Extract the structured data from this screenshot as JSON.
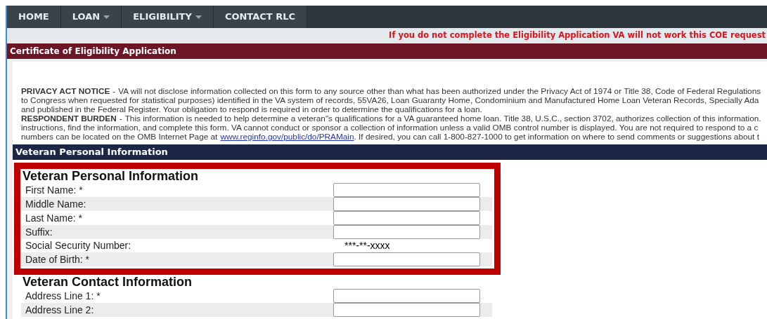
{
  "nav": [
    {
      "label": "HOME",
      "dropdown": false
    },
    {
      "label": "LOAN",
      "dropdown": true
    },
    {
      "label": "ELIGIBILITY",
      "dropdown": true
    },
    {
      "label": "CONTACT RLC",
      "dropdown": false
    }
  ],
  "warning": "If you do not complete the Eligibility Application VA will not work this COE request",
  "page_title": "Certificate of Eligibility Application",
  "notice": [
    {
      "heading": "PRIVACY ACT NOTICE",
      "separator": "-",
      "lines": [
        "VA will not disclose information collected on this form to any source other than what has been authorized under the Privacy Act of 1974 or Title 38, Code of Federal Regulations",
        "to Congress when requested for statistical purposes) identified in the VA system of records, 55VA26, Loan Guaranty Home, Condominium and Manufactured Home Loan Veteran Records, Specially Ada",
        "and published in the Federal Register. Your obligation to respond is required in order to determine the qualifications for a loan."
      ]
    },
    {
      "heading": "RESPONDENT BURDEN",
      "separator": "-",
      "lines": [
        "This information is needed to help determine a veteran\"s qualifications for a VA guaranteed home loan. Title 38, U.S.C., section 3702, authorizes collection of this information.",
        "instructions, find the information, and complete this form. VA cannot conduct or sponsor a collection of information unless a valid OMB control number is displayed. You are not required to respond to a c"
      ],
      "last_line": {
        "before": "numbers can be located on the OMB Internet Page at",
        "link": "www.reginfo.gov/public/do/PRAMain",
        "after": ". If desired, you can call 1-800-827-1000 to get information on where to send comments or suggestions about t"
      }
    }
  ],
  "section_header": "Veteran Personal Information",
  "groups": [
    {
      "title": "Veteran Personal Information",
      "highlighted": true,
      "fields": [
        {
          "label": "First Name: *",
          "kind": "input"
        },
        {
          "label": "Middle Name:",
          "kind": "input"
        },
        {
          "label": "Last Name: *",
          "kind": "input"
        },
        {
          "label": "Suffix:",
          "kind": "input"
        },
        {
          "label": "Social Security Number:",
          "kind": "text",
          "value": "***-**-xxxx"
        },
        {
          "label": "Date of Birth: *",
          "kind": "input"
        }
      ]
    },
    {
      "title": "Veteran Contact Information",
      "highlighted": false,
      "fields": [
        {
          "label": "Address Line 1: *",
          "kind": "input"
        },
        {
          "label": "Address Line 2:",
          "kind": "input"
        }
      ]
    }
  ]
}
